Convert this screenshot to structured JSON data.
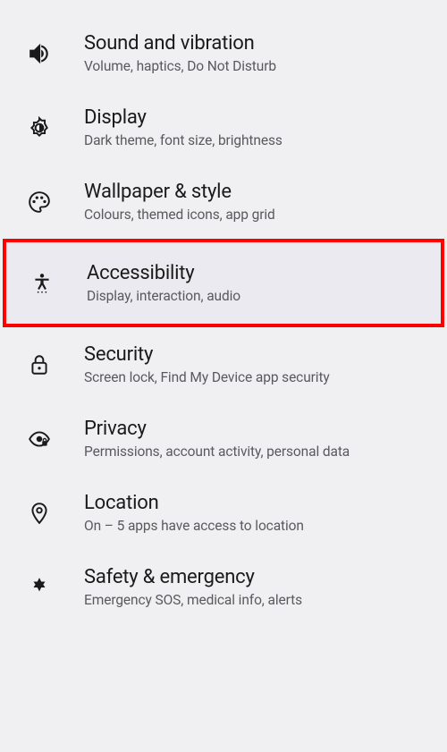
{
  "settings": [
    {
      "id": "sound-vibration",
      "icon": "volume-icon",
      "title": "Sound and vibration",
      "subtitle": "Volume, haptics, Do Not Disturb",
      "highlighted": false
    },
    {
      "id": "display",
      "icon": "brightness-icon",
      "title": "Display",
      "subtitle": "Dark theme, font size, brightness",
      "highlighted": false
    },
    {
      "id": "wallpaper-style",
      "icon": "palette-icon",
      "title": "Wallpaper & style",
      "subtitle": "Colours, themed icons, app grid",
      "highlighted": false
    },
    {
      "id": "accessibility",
      "icon": "accessibility-icon",
      "title": "Accessibility",
      "subtitle": "Display, interaction, audio",
      "highlighted": true
    },
    {
      "id": "security",
      "icon": "lock-icon",
      "title": "Security",
      "subtitle": "Screen lock, Find My Device app security",
      "highlighted": false
    },
    {
      "id": "privacy",
      "icon": "privacy-icon",
      "title": "Privacy",
      "subtitle": "Permissions, account activity, personal data",
      "highlighted": false
    },
    {
      "id": "location",
      "icon": "location-icon",
      "title": "Location",
      "subtitle": "On – 5 apps have access to location",
      "highlighted": false
    },
    {
      "id": "safety-emergency",
      "icon": "medical-icon",
      "title": "Safety & emergency",
      "subtitle": "Emergency SOS, medical info, alerts",
      "highlighted": false
    }
  ]
}
